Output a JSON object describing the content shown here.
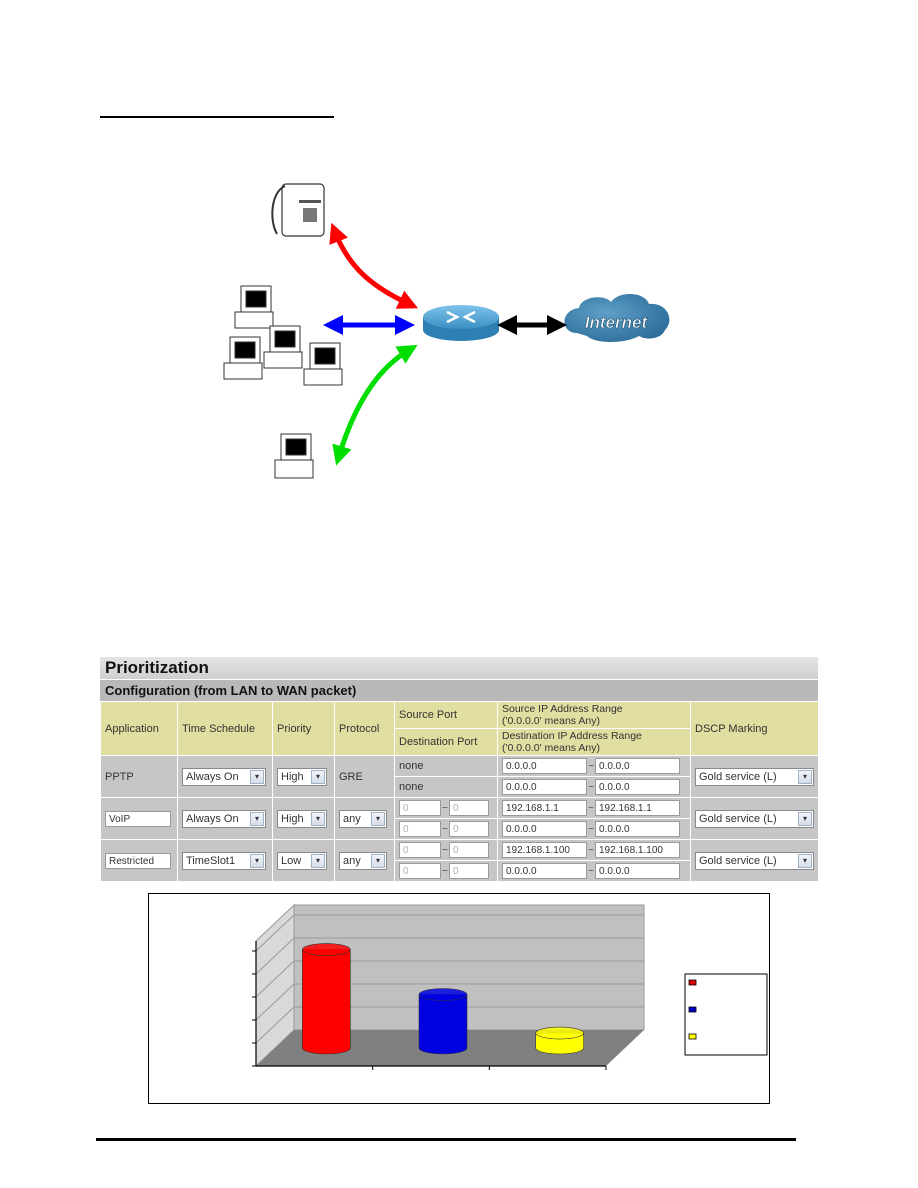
{
  "document": {
    "section_rule": "underline"
  },
  "diagram": {
    "nodes": [
      {
        "id": "phone",
        "icon": "telephone-icon"
      },
      {
        "id": "pc-group",
        "icon": "computer-group-icon"
      },
      {
        "id": "single-pc",
        "icon": "computer-icon"
      },
      {
        "id": "router",
        "icon": "router-icon"
      },
      {
        "id": "internet",
        "icon": "cloud-icon",
        "label": "Internet"
      }
    ],
    "links": [
      {
        "from": "phone",
        "to": "router",
        "color": "#ff0000"
      },
      {
        "from": "pc-group",
        "to": "router",
        "color": "#0000ff"
      },
      {
        "from": "single-pc",
        "to": "router",
        "color": "#00dd00"
      },
      {
        "from": "router",
        "to": "internet",
        "color": "#000000"
      }
    ]
  },
  "prioritization": {
    "title": "Prioritization",
    "subtitle": "Configuration (from LAN to WAN packet)",
    "headers": {
      "application": "Application",
      "time_schedule": "Time Schedule",
      "priority": "Priority",
      "protocol": "Protocol",
      "source_port": "Source Port",
      "destination_port": "Destination Port",
      "source_ip": "Source IP Address Range",
      "source_ip_note": "('0.0.0.0' means Any)",
      "destination_ip": "Destination IP Address Range",
      "destination_ip_note": "('0.0.0.0' means Any)",
      "dscp": "DSCP Marking"
    },
    "rows": [
      {
        "application": "PPTP",
        "time_schedule": "Always On",
        "priority": "High",
        "protocol": "GRE",
        "source_port": "none",
        "destination_port": "none",
        "src_ip_from": "0.0.0.0",
        "src_ip_to": "0.0.0.0",
        "dst_ip_from": "0.0.0.0",
        "dst_ip_to": "0.0.0.0",
        "dscp": "Gold service (L)"
      },
      {
        "application": "VoIP",
        "time_schedule": "Always On",
        "priority": "High",
        "protocol": "any",
        "src_port_from": "0",
        "src_port_to": "0",
        "dst_port_from": "0",
        "dst_port_to": "0",
        "src_ip_from": "192.168.1.1",
        "src_ip_to": "192.168.1.1",
        "dst_ip_from": "0.0.0.0",
        "dst_ip_to": "0.0.0.0",
        "dscp": "Gold service (L)"
      },
      {
        "application": "Restricted",
        "time_schedule": "TimeSlot1",
        "priority": "Low",
        "protocol": "any",
        "src_port_from": "0",
        "src_port_to": "0",
        "dst_port_from": "0",
        "dst_port_to": "0",
        "src_ip_from": "192.168.1.100",
        "src_ip_to": "192.168.1.100",
        "dst_ip_from": "0.0.0.0",
        "dst_ip_to": "0.0.0.0",
        "dscp": "Gold service (L)"
      }
    ],
    "tilde": "~",
    "dropdown_arrow": "▾"
  },
  "chart_data": {
    "type": "bar",
    "style": "3d-cylinder",
    "title": "",
    "xlabel": "",
    "ylabel": "",
    "categories": [
      "",
      "",
      ""
    ],
    "values": [
      4.6,
      2.5,
      0.7
    ],
    "colors": [
      "#ff0000",
      "#0000e0",
      "#ffff00"
    ],
    "ylim": [
      0,
      5
    ],
    "y_ticks": 5,
    "grid": true,
    "legend": {
      "placement": "right",
      "entries": [
        {
          "label": "",
          "color": "#dd0000"
        },
        {
          "label": "",
          "color": "#0000cc"
        },
        {
          "label": "",
          "color": "#ffff00"
        }
      ]
    }
  }
}
